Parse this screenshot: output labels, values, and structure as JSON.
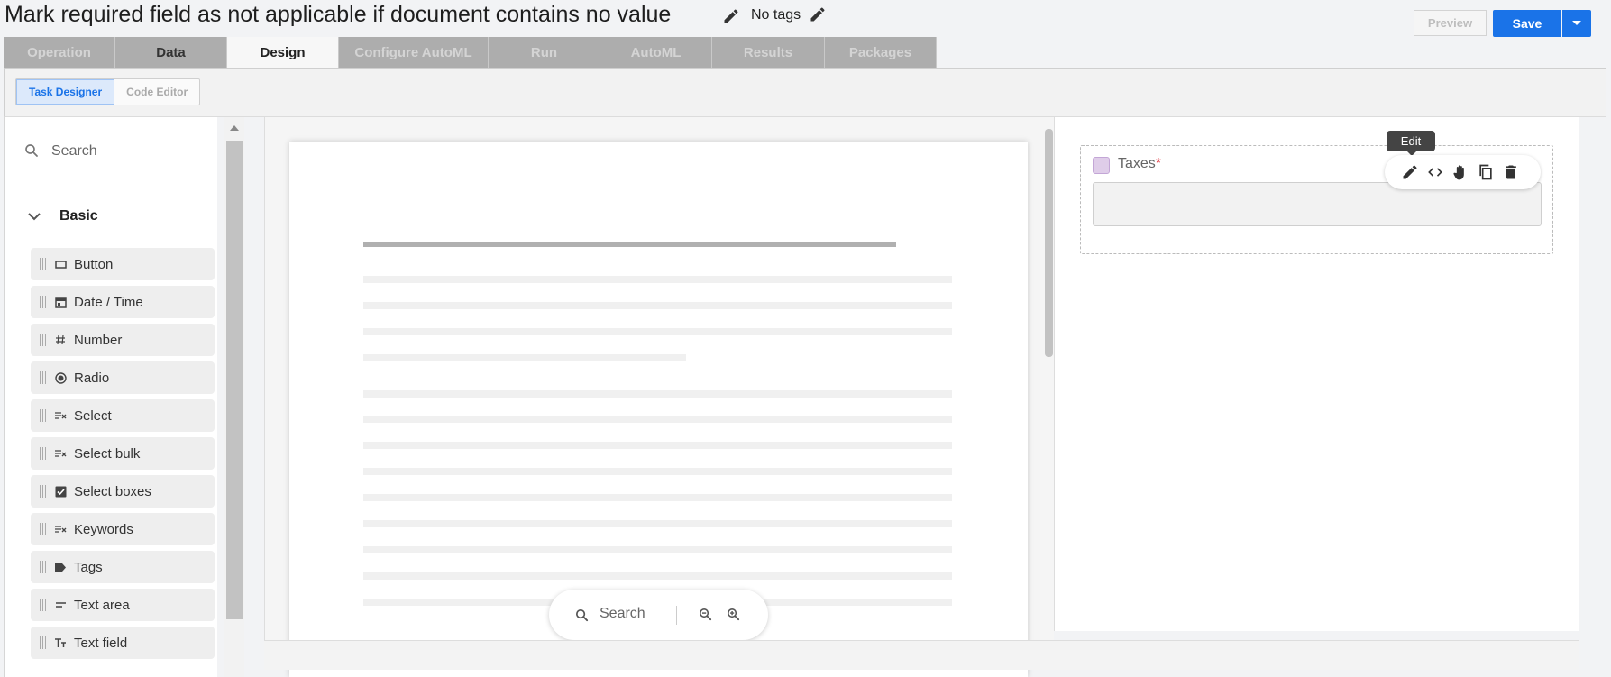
{
  "header": {
    "title": "Mark required field as not applicable if document contains no value",
    "tags_label": "No tags"
  },
  "tabs": [
    {
      "label": "Operation"
    },
    {
      "label": "Data"
    },
    {
      "label": "Design"
    },
    {
      "label": "Configure AutoML"
    },
    {
      "label": "Run"
    },
    {
      "label": "AutoML"
    },
    {
      "label": "Results"
    },
    {
      "label": "Packages"
    }
  ],
  "active_tab": "Design",
  "toolbar": {
    "task_designer_label": "Task Designer",
    "code_editor_label": "Code Editor",
    "preview_label": "Preview",
    "save_label": "Save"
  },
  "palette": {
    "search_placeholder": "Search",
    "section_label": "Basic",
    "items": [
      {
        "label": "Button",
        "icon": "button-icon"
      },
      {
        "label": "Date / Time",
        "icon": "calendar-icon"
      },
      {
        "label": "Number",
        "icon": "hash-icon"
      },
      {
        "label": "Radio",
        "icon": "radio-icon"
      },
      {
        "label": "Select",
        "icon": "select-icon"
      },
      {
        "label": "Select bulk",
        "icon": "select-icon"
      },
      {
        "label": "Select boxes",
        "icon": "checkbox-icon"
      },
      {
        "label": "Keywords",
        "icon": "select-icon"
      },
      {
        "label": "Tags",
        "icon": "tag-icon"
      },
      {
        "label": "Text area",
        "icon": "text-area-icon"
      },
      {
        "label": "Text field",
        "icon": "text-field-icon"
      }
    ]
  },
  "viewer": {
    "search_label": "Search"
  },
  "form": {
    "field_label": "Taxes",
    "required_marker": "*",
    "tooltip": "Edit"
  },
  "colors": {
    "accent": "#1a73e8",
    "tab_inactive": "#adadad",
    "required": "#e0303a",
    "field_check": "#dfcde9"
  }
}
